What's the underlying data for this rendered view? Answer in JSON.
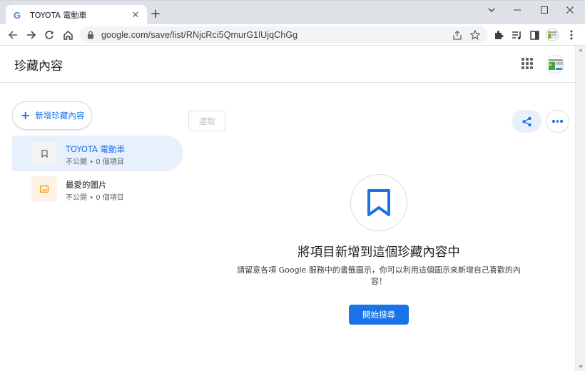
{
  "browser": {
    "tab_title": "TOYOTA 電動車",
    "tab_favicon_letter": "G",
    "url": "google.com/save/list/RNjcRci5QmurG1lUjqChGg",
    "new_tab_symbol": "+",
    "icons": [
      "back-icon",
      "forward-icon",
      "reload-icon",
      "home-icon",
      "lock-icon",
      "share-page-icon",
      "bookmark-star-icon",
      "extensions-icon",
      "reading-list-icon",
      "side-panel-icon",
      "profile-avatar-icon",
      "menu-icon",
      "minimize-icon",
      "maximize-icon",
      "close-window-icon",
      "tab-list-icon"
    ]
  },
  "app": {
    "title": "珍藏內容"
  },
  "sidebar": {
    "new_list_label": "新增珍藏內容",
    "lists": [
      {
        "name": "TOYOTA 電動車",
        "meta": "不公開 • 0 個項目",
        "selected": true,
        "icon": "bookmark-icon"
      },
      {
        "name": "最愛的圖片",
        "meta": "不公開 • 0 個項目",
        "selected": false,
        "icon": "image-icon"
      }
    ]
  },
  "content": {
    "select_label": "選取",
    "empty_title": "將項目新增到這個珍藏內容中",
    "empty_desc": "請留意各項 Google 服務中的書籤圖示，你可以利用這個圖示來新增自己喜歡的內容！",
    "start_button": "開始搜尋"
  },
  "colors": {
    "accent": "#1a73e8",
    "selected_bg": "#e8f0fe",
    "image_thumb_bg": "#fef3e6",
    "image_icon": "#f29900"
  }
}
